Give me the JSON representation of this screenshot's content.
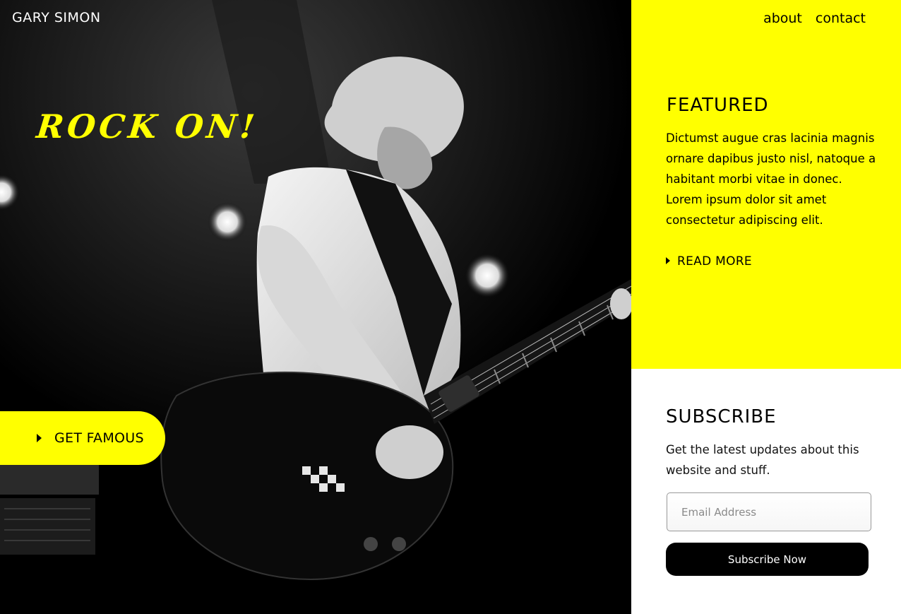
{
  "site": {
    "brand": "GARY SIMON",
    "accent_color": "#ffff00"
  },
  "nav": {
    "items": [
      "about",
      "contact"
    ]
  },
  "hero": {
    "tagline": "ROCK ON!",
    "cta_label": "GET FAMOUS",
    "cta_icon": "play-triangle-icon",
    "image_alt": "Guitarist playing electric guitar on stage (black and white)"
  },
  "featured": {
    "heading": "FEATURED",
    "body": "Dictumst augue cras lacinia magnis ornare dapibus justo nisl, natoque a habitant morbi vitae in donec. Lorem ipsum dolor sit amet consectetur adipiscing elit.",
    "read_more_label": "READ MORE",
    "read_more_icon": "play-triangle-icon"
  },
  "subscribe": {
    "heading": "SUBSCRIBE",
    "body": "Get the latest updates about this website and stuff.",
    "email_placeholder": "Email Address",
    "email_value": "",
    "button_label": "Subscribe Now"
  }
}
